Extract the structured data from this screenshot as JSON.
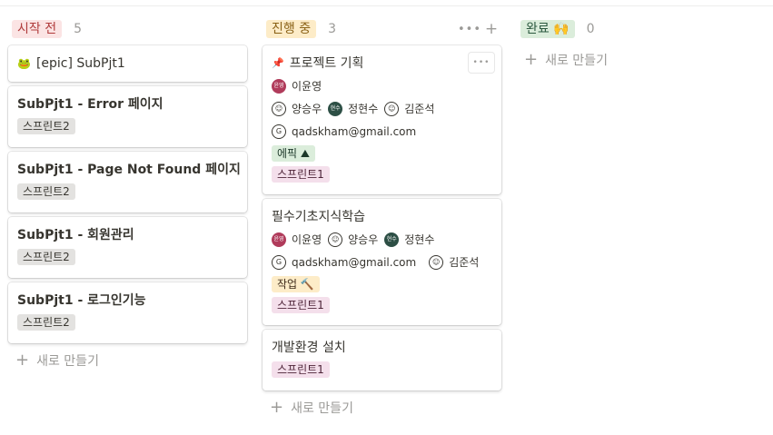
{
  "columns": [
    {
      "status": "시작 전",
      "count": "5",
      "pill_bg": "#fbe4e4",
      "pill_color": "#b03b3b",
      "cards": [
        {
          "title": "[epic] SubPjt1",
          "icon": "frog-icon",
          "icon_glyph": "🐸",
          "bold": true,
          "tags": []
        },
        {
          "title": "SubPjt1 - Error 페이지",
          "bold": true,
          "tags": [
            {
              "label": "스프린트2",
              "bg": "#e3e2e0",
              "color": "#37352f"
            }
          ]
        },
        {
          "title": "SubPjt1 - Page Not Found 페이지",
          "bold": true,
          "tags": [
            {
              "label": "스프린트2",
              "bg": "#e3e2e0",
              "color": "#37352f"
            }
          ]
        },
        {
          "title": "SubPjt1 - 회원관리",
          "bold": true,
          "tags": [
            {
              "label": "스프린트2",
              "bg": "#e3e2e0",
              "color": "#37352f"
            }
          ]
        },
        {
          "title": "SubPjt1 - 로그인기능",
          "bold": true,
          "tags": [
            {
              "label": "스프린트2",
              "bg": "#e3e2e0",
              "color": "#37352f"
            }
          ]
        }
      ],
      "new_label": "새로 만들기"
    },
    {
      "status": "진행 중",
      "count": "3",
      "pill_bg": "#fdecc8",
      "pill_color": "#8a6116",
      "cards": [
        {
          "title": "프로젝트 기획",
          "icon": "pushpin-icon",
          "icon_glyph": "📌",
          "bold": false,
          "people_row_1": [
            {
              "name": "이윤영",
              "avatar": "윤영",
              "style": "photo",
              "bg": "#b03b5b"
            }
          ],
          "people_row_2": [
            {
              "name": "양승우",
              "avatar": "☺",
              "style": "drawn"
            },
            {
              "name": "정현수",
              "avatar": "현수",
              "style": "photo",
              "bg": "#2d4f45"
            },
            {
              "name": "김준석",
              "avatar": "☺",
              "style": "drawn"
            }
          ],
          "email": "qadskham@gmail.com",
          "tags": [
            {
              "label": "에픽 ⛰",
              "bg": "#dbeddb",
              "color": "#1c3829"
            }
          ],
          "tags2": [
            {
              "label": "스프린트1",
              "bg": "#f4dfeb",
              "color": "#4c2337"
            }
          ],
          "more": "•••"
        },
        {
          "title": "필수기초지식학습",
          "bold": false,
          "people_row_1": [
            {
              "name": "이윤영",
              "avatar": "윤영",
              "style": "photo",
              "bg": "#b03b5b"
            },
            {
              "name": "양승우",
              "avatar": "☺",
              "style": "drawn"
            },
            {
              "name": "정현수",
              "avatar": "현수",
              "style": "photo",
              "bg": "#2d4f45"
            }
          ],
          "email": "qadskham@gmail.com",
          "people_row_2": [
            {
              "name": "김준석",
              "avatar": "☺",
              "style": "drawn"
            }
          ],
          "tags": [
            {
              "label": "작업 🔨",
              "bg": "#fdecc8",
              "color": "#402c1b"
            }
          ],
          "tags2": [
            {
              "label": "스프린트1",
              "bg": "#f4dfeb",
              "color": "#4c2337"
            }
          ]
        },
        {
          "title": "개발환경 설치",
          "bold": false,
          "tags": [
            {
              "label": "스프린트1",
              "bg": "#f4dfeb",
              "color": "#4c2337"
            }
          ]
        }
      ],
      "new_label": "새로 만들기"
    },
    {
      "status": "완료 🙌",
      "count": "0",
      "pill_bg": "#dbeddb",
      "pill_color": "#2b593f",
      "cards": [],
      "new_label": "새로 만들기"
    }
  ],
  "email_avatar": "G"
}
